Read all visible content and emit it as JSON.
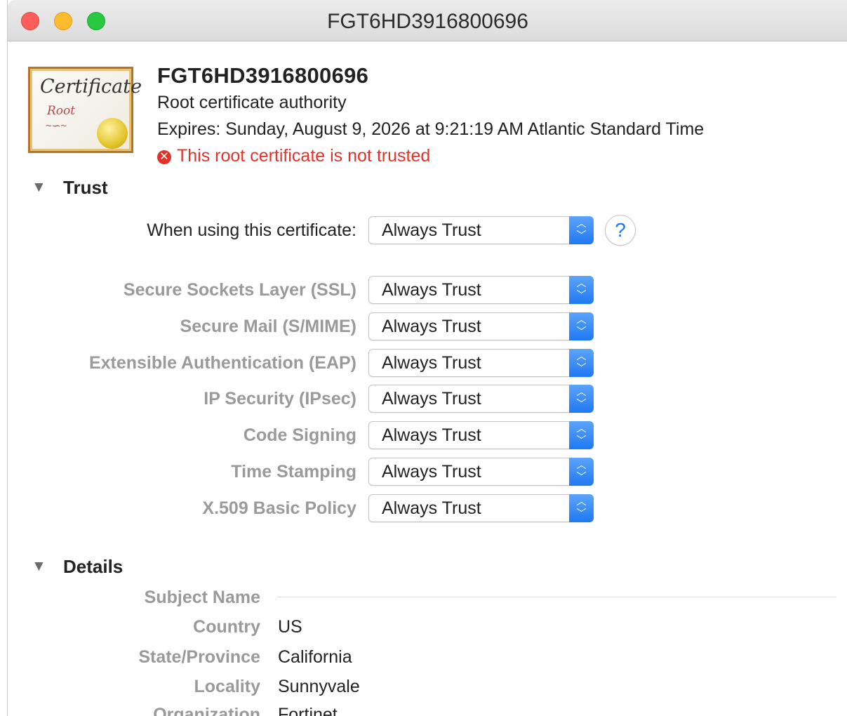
{
  "window": {
    "title": "FGT6HD3916800696"
  },
  "certificate": {
    "icon_text_1": "Certificate",
    "icon_text_2": "Root",
    "name": "FGT6HD3916800696",
    "type": "Root certificate authority",
    "expires": "Expires: Sunday, August 9, 2026 at 9:21:19 AM Atlantic Standard Time",
    "warning": "This root certificate is not trusted"
  },
  "trust": {
    "section_label": "Trust",
    "toggle": "▼",
    "main_label": "When using this certificate:",
    "main_value": "Always Trust",
    "help": "?",
    "rows": [
      {
        "label": "Secure Sockets Layer (SSL)",
        "value": "Always Trust"
      },
      {
        "label": "Secure Mail (S/MIME)",
        "value": "Always Trust"
      },
      {
        "label": "Extensible Authentication (EAP)",
        "value": "Always Trust"
      },
      {
        "label": "IP Security (IPsec)",
        "value": "Always Trust"
      },
      {
        "label": "Code Signing",
        "value": "Always Trust"
      },
      {
        "label": "Time Stamping",
        "value": "Always Trust"
      },
      {
        "label": "X.509 Basic Policy",
        "value": "Always Trust"
      }
    ]
  },
  "details": {
    "section_label": "Details",
    "toggle": "▼",
    "subject_header": "Subject Name",
    "fields": [
      {
        "label": "Country",
        "value": "US"
      },
      {
        "label": "State/Province",
        "value": "California"
      },
      {
        "label": "Locality",
        "value": "Sunnyvale"
      },
      {
        "label": "Organization",
        "value": "Fortinet"
      }
    ]
  },
  "colors": {
    "accent": "#1f79f2",
    "error": "#e0342b"
  }
}
